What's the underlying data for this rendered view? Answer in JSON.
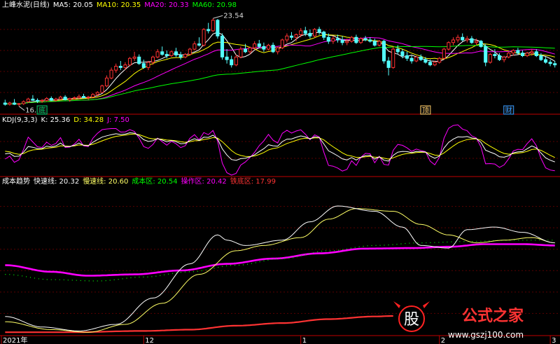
{
  "chart_data": [
    {
      "type": "line",
      "panel": "price",
      "title": "上峰水泥(日线)",
      "indicators": [
        {
          "name": "MA5",
          "label": "MA5: 20.05",
          "value": 20.05,
          "color": "#ffffff"
        },
        {
          "name": "MA10",
          "label": "MA10: 20.35",
          "value": 20.35,
          "color": "#ffff00"
        },
        {
          "name": "MA20",
          "label": "MA20: 20.33",
          "value": 20.33,
          "color": "#ff00ff"
        },
        {
          "name": "MA60",
          "label": "MA60: 20.98",
          "value": 20.98,
          "color": "#00ff00"
        }
      ],
      "annotations": [
        {
          "text": "23.54",
          "value": 23.54,
          "kind": "high"
        },
        {
          "text": "16.85",
          "value": 16.85,
          "kind": "low"
        }
      ],
      "markers": [
        {
          "text": "底",
          "color": "#00cc66"
        },
        {
          "text": "顶",
          "color": "#ffcc66"
        },
        {
          "text": "财",
          "color": "#3399ff"
        }
      ],
      "ylim": [
        16.3,
        24.3
      ],
      "candles": [
        [
          17.1,
          17.35,
          16.9,
          17.0
        ],
        [
          17.0,
          17.2,
          16.9,
          17.1
        ],
        [
          17.1,
          17.4,
          16.95,
          17.0
        ],
        [
          17.0,
          17.1,
          16.85,
          17.05
        ],
        [
          17.05,
          17.3,
          16.95,
          17.2
        ],
        [
          17.2,
          17.5,
          17.1,
          17.4
        ],
        [
          17.4,
          17.7,
          17.3,
          17.3
        ],
        [
          17.3,
          17.45,
          17.1,
          17.25
        ],
        [
          17.25,
          17.4,
          17.1,
          17.3
        ],
        [
          17.3,
          17.55,
          17.2,
          17.45
        ],
        [
          17.45,
          17.6,
          17.25,
          17.3
        ],
        [
          17.3,
          17.5,
          17.2,
          17.4
        ],
        [
          17.4,
          17.65,
          17.3,
          17.55
        ],
        [
          17.55,
          17.7,
          17.3,
          17.35
        ],
        [
          17.35,
          17.5,
          17.2,
          17.45
        ],
        [
          17.45,
          17.6,
          17.35,
          17.5
        ],
        [
          17.5,
          17.75,
          17.4,
          17.6
        ],
        [
          17.6,
          17.8,
          17.45,
          17.5
        ],
        [
          17.5,
          17.65,
          17.35,
          17.55
        ],
        [
          17.55,
          17.85,
          17.5,
          17.75
        ],
        [
          17.75,
          18.0,
          17.6,
          17.9
        ],
        [
          17.9,
          18.5,
          17.85,
          18.4
        ],
        [
          18.4,
          19.2,
          18.3,
          19.0
        ],
        [
          19.0,
          19.8,
          18.9,
          19.6
        ],
        [
          19.6,
          20.1,
          19.4,
          19.9
        ],
        [
          19.9,
          20.3,
          19.6,
          19.8
        ],
        [
          19.8,
          20.2,
          19.6,
          20.0
        ],
        [
          20.0,
          20.6,
          19.9,
          20.5
        ],
        [
          20.5,
          21.0,
          20.3,
          20.6
        ],
        [
          20.6,
          20.8,
          20.0,
          20.1
        ],
        [
          20.1,
          20.4,
          19.7,
          19.8
        ],
        [
          19.8,
          20.3,
          19.6,
          20.2
        ],
        [
          20.2,
          20.7,
          20.0,
          20.6
        ],
        [
          20.6,
          21.2,
          20.5,
          21.0
        ],
        [
          21.0,
          21.4,
          20.7,
          20.8
        ],
        [
          20.8,
          21.1,
          20.5,
          20.7
        ],
        [
          20.7,
          21.1,
          20.6,
          21.0
        ],
        [
          21.0,
          21.3,
          20.6,
          20.75
        ],
        [
          20.75,
          21.0,
          20.4,
          20.6
        ],
        [
          20.6,
          20.9,
          20.5,
          20.8
        ],
        [
          20.8,
          21.3,
          20.7,
          21.2
        ],
        [
          21.2,
          21.8,
          21.1,
          21.6
        ],
        [
          21.6,
          22.1,
          21.4,
          21.5
        ],
        [
          21.5,
          22.8,
          21.4,
          22.7
        ],
        [
          22.7,
          23.2,
          22.4,
          22.6
        ],
        [
          22.6,
          23.54,
          22.5,
          23.4
        ],
        [
          23.4,
          23.5,
          22.0,
          22.2
        ],
        [
          22.2,
          22.4,
          20.4,
          20.6
        ],
        [
          20.6,
          21.2,
          20.1,
          20.4
        ],
        [
          20.4,
          20.7,
          19.8,
          20.0
        ],
        [
          20.0,
          20.8,
          19.9,
          20.6
        ],
        [
          20.6,
          21.4,
          20.5,
          21.2
        ],
        [
          21.2,
          21.6,
          20.9,
          21.0
        ],
        [
          21.0,
          21.4,
          20.8,
          21.3
        ],
        [
          21.3,
          21.8,
          21.2,
          21.6
        ],
        [
          21.6,
          21.9,
          21.3,
          21.4
        ],
        [
          21.4,
          21.7,
          21.0,
          21.2
        ],
        [
          21.2,
          21.6,
          21.1,
          21.5
        ],
        [
          21.5,
          21.7,
          20.9,
          21.0
        ],
        [
          21.0,
          21.4,
          20.8,
          21.3
        ],
        [
          21.3,
          22.0,
          21.2,
          21.9
        ],
        [
          21.9,
          22.4,
          21.7,
          22.2
        ],
        [
          22.2,
          22.5,
          21.9,
          22.1
        ],
        [
          22.1,
          22.4,
          21.8,
          22.3
        ],
        [
          22.3,
          22.8,
          22.1,
          22.6
        ],
        [
          22.6,
          22.9,
          22.2,
          22.4
        ],
        [
          22.4,
          22.7,
          22.0,
          22.2
        ],
        [
          22.2,
          22.8,
          22.1,
          22.7
        ],
        [
          22.7,
          22.9,
          22.3,
          22.5
        ],
        [
          22.5,
          22.6,
          21.9,
          22.1
        ],
        [
          22.1,
          22.4,
          21.6,
          21.8
        ],
        [
          21.8,
          22.2,
          21.6,
          22.0
        ],
        [
          22.0,
          22.3,
          21.7,
          21.9
        ],
        [
          21.9,
          22.2,
          21.5,
          21.7
        ],
        [
          21.7,
          22.0,
          21.5,
          21.8
        ],
        [
          21.8,
          22.2,
          21.7,
          22.1
        ],
        [
          22.1,
          22.3,
          21.6,
          21.7
        ],
        [
          21.7,
          22.1,
          21.6,
          22.0
        ],
        [
          22.0,
          22.2,
          21.8,
          21.9
        ],
        [
          21.9,
          22.1,
          21.7,
          21.8
        ],
        [
          21.8,
          22.0,
          21.4,
          21.5
        ],
        [
          21.5,
          21.9,
          21.4,
          21.8
        ],
        [
          21.8,
          21.9,
          20.1,
          20.3
        ],
        [
          20.3,
          20.6,
          19.2,
          19.8
        ],
        [
          19.8,
          21.4,
          19.7,
          21.2
        ],
        [
          21.2,
          21.5,
          20.8,
          21.0
        ],
        [
          21.0,
          21.2,
          20.5,
          20.7
        ],
        [
          20.7,
          21.0,
          20.3,
          20.5
        ],
        [
          20.5,
          20.7,
          20.1,
          20.3
        ],
        [
          20.3,
          20.7,
          20.2,
          20.6
        ],
        [
          20.6,
          20.8,
          20.3,
          20.4
        ],
        [
          20.4,
          20.6,
          20.1,
          20.2
        ],
        [
          20.2,
          20.4,
          19.9,
          20.0
        ],
        [
          20.0,
          20.3,
          19.9,
          20.2
        ],
        [
          20.2,
          20.6,
          20.1,
          20.5
        ],
        [
          20.5,
          21.3,
          20.4,
          21.2
        ],
        [
          21.2,
          21.8,
          21.1,
          21.7
        ],
        [
          21.7,
          22.1,
          21.5,
          21.9
        ],
        [
          21.9,
          22.3,
          21.7,
          22.1
        ],
        [
          22.1,
          22.4,
          21.8,
          21.9
        ],
        [
          21.9,
          22.2,
          21.7,
          22.0
        ],
        [
          22.0,
          22.2,
          21.6,
          21.7
        ],
        [
          21.7,
          22.0,
          21.5,
          21.8
        ],
        [
          21.8,
          21.9,
          21.3,
          21.4
        ],
        [
          21.4,
          21.6,
          19.9,
          20.2
        ],
        [
          20.2,
          20.9,
          20.1,
          20.8
        ],
        [
          20.8,
          21.2,
          20.5,
          20.7
        ],
        [
          20.7,
          20.9,
          20.3,
          20.4
        ],
        [
          20.4,
          20.7,
          20.2,
          20.6
        ],
        [
          20.6,
          21.0,
          20.5,
          20.9
        ],
        [
          20.9,
          21.2,
          20.7,
          21.1
        ],
        [
          21.1,
          21.3,
          20.8,
          20.9
        ],
        [
          20.9,
          21.1,
          20.6,
          20.7
        ],
        [
          20.7,
          21.0,
          20.6,
          20.9
        ],
        [
          20.9,
          21.2,
          20.7,
          21.0
        ],
        [
          21.0,
          21.2,
          20.6,
          20.7
        ],
        [
          20.7,
          20.9,
          20.3,
          20.4
        ],
        [
          20.4,
          20.6,
          20.1,
          20.2
        ],
        [
          20.2,
          20.4,
          19.9,
          20.1
        ],
        [
          20.1,
          20.3,
          19.8,
          20.0
        ]
      ]
    },
    {
      "type": "line",
      "panel": "kdj",
      "title": "KDJ(9,3,3)",
      "indicators": [
        {
          "name": "K",
          "label": "K: 25.36",
          "value": 25.36,
          "color": "#ffffff"
        },
        {
          "name": "D",
          "label": "D: 34.28",
          "value": 34.28,
          "color": "#ffff00"
        },
        {
          "name": "J",
          "label": "J: 7.50",
          "value": 7.5,
          "color": "#ff00ff"
        }
      ],
      "ylim": [
        -10,
        110
      ]
    },
    {
      "type": "line",
      "panel": "cost_trend",
      "title": "成本趋势",
      "indicators": [
        {
          "name": "快速线",
          "label": "快速线: 20.32",
          "value": 20.32,
          "color": "#ffffff"
        },
        {
          "name": "慢速线",
          "label": "慢速线: 20.60",
          "value": 20.6,
          "color": "#ffff66"
        },
        {
          "name": "成本区",
          "label": "成本区: 20.54",
          "value": 20.54,
          "color": "#00ff00"
        },
        {
          "name": "操作区",
          "label": "操作区: 20.42",
          "value": 20.42,
          "color": "#ff00ff"
        },
        {
          "name": "铁底区",
          "label": "铁底区: 17.99",
          "value": 17.99,
          "color": "#ff3333"
        }
      ],
      "series": [
        {
          "name": "快速线",
          "points": [
            [
              0,
              17.6
            ],
            [
              8,
              17.2
            ],
            [
              16,
              17.05
            ],
            [
              24,
              17.3
            ],
            [
              32,
              18.3
            ],
            [
              40,
              19.6
            ],
            [
              46,
              20.7
            ],
            [
              48,
              20.5
            ],
            [
              52,
              20.3
            ],
            [
              60,
              20.5
            ],
            [
              66,
              21.2
            ],
            [
              72,
              21.8
            ],
            [
              80,
              21.6
            ],
            [
              86,
              21.0
            ],
            [
              90,
              20.3
            ],
            [
              96,
              20.2
            ],
            [
              100,
              20.9
            ],
            [
              106,
              21.0
            ],
            [
              112,
              20.8
            ],
            [
              119,
              20.4
            ]
          ]
        },
        {
          "name": "慢速线",
          "points": [
            [
              0,
              17.4
            ],
            [
              10,
              17.1
            ],
            [
              18,
              17.0
            ],
            [
              26,
              17.3
            ],
            [
              34,
              18.1
            ],
            [
              42,
              19.2
            ],
            [
              50,
              20.1
            ],
            [
              56,
              20.3
            ],
            [
              64,
              20.6
            ],
            [
              70,
              21.3
            ],
            [
              76,
              21.7
            ],
            [
              84,
              21.6
            ],
            [
              90,
              21.1
            ],
            [
              96,
              20.7
            ],
            [
              102,
              20.4
            ],
            [
              108,
              20.5
            ],
            [
              114,
              20.6
            ],
            [
              119,
              20.4
            ]
          ]
        },
        {
          "name": "成本区",
          "points": [
            [
              0,
              19.2
            ],
            [
              10,
              19.0
            ],
            [
              20,
              18.95
            ],
            [
              30,
              19.1
            ],
            [
              40,
              19.3
            ],
            [
              50,
              19.55
            ],
            [
              60,
              19.8
            ],
            [
              70,
              20.1
            ],
            [
              80,
              20.3
            ],
            [
              90,
              20.4
            ],
            [
              100,
              20.45
            ],
            [
              110,
              20.5
            ],
            [
              119,
              20.5
            ]
          ]
        },
        {
          "name": "操作区",
          "points": [
            [
              0,
              19.55
            ],
            [
              10,
              19.3
            ],
            [
              18,
              19.15
            ],
            [
              28,
              19.2
            ],
            [
              38,
              19.35
            ],
            [
              48,
              19.6
            ],
            [
              58,
              19.8
            ],
            [
              68,
              20.0
            ],
            [
              78,
              20.18
            ],
            [
              88,
              20.2
            ],
            [
              96,
              20.25
            ],
            [
              104,
              20.35
            ],
            [
              112,
              20.35
            ],
            [
              119,
              20.3
            ]
          ]
        },
        {
          "name": "铁底区",
          "points": [
            [
              0,
              17.0
            ],
            [
              14,
              17.0
            ],
            [
              30,
              17.05
            ],
            [
              40,
              17.1
            ],
            [
              50,
              17.25
            ],
            [
              60,
              17.35
            ],
            [
              70,
              17.5
            ],
            [
              80,
              17.6
            ],
            [
              84,
              17.62
            ]
          ]
        }
      ],
      "ylim": [
        16.9,
        22.6
      ]
    }
  ],
  "x_axis": {
    "labels": [
      "2021年",
      "12",
      "1",
      "2",
      "3"
    ],
    "start": 0,
    "end": 119
  },
  "watermark": {
    "text": "公式之家",
    "url": "www.gszj100.com",
    "logo_char": "股"
  }
}
